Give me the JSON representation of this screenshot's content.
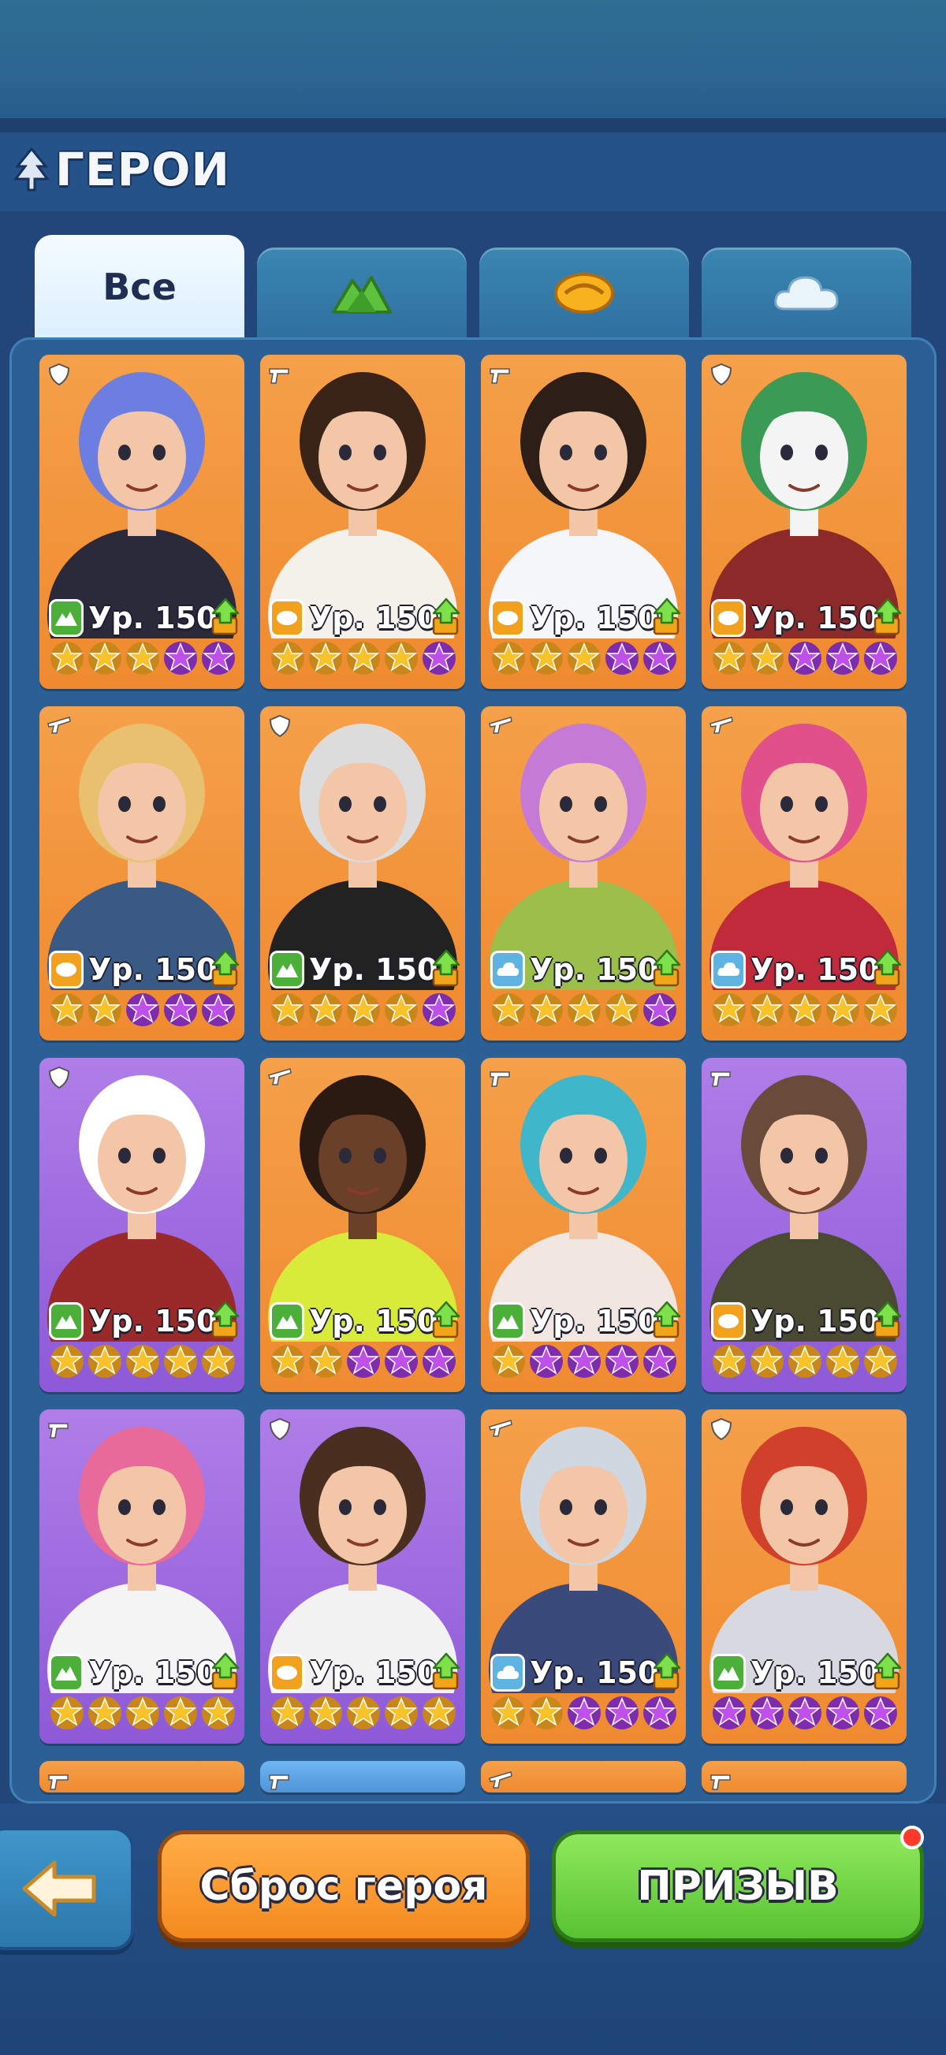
{
  "header": {
    "title": "ГЕРОИ",
    "title_icon": "tree-icon"
  },
  "tabs": [
    {
      "label": "Все",
      "icon": null,
      "active": true
    },
    {
      "label": "",
      "icon": "mountain-icon",
      "active": false
    },
    {
      "label": "",
      "icon": "sun-icon",
      "active": false
    },
    {
      "label": "",
      "icon": "cloud-icon",
      "active": false
    }
  ],
  "colors": {
    "orange_card": "#f29439",
    "purple_card": "#9d6ae0",
    "faction_mountain": "#4caf3a",
    "faction_sun": "#f2a11e",
    "faction_cloud": "#5fb3e0",
    "star_gold": "#f7c22a",
    "star_purple": "#c050ea"
  },
  "heroes": [
    {
      "rarity": "orange",
      "role": "shield-icon",
      "faction": "mountain",
      "level": "Ур. 150",
      "upgrade": "up-arrow-icon",
      "stars": [
        "gold",
        "gold",
        "gold",
        "purple",
        "purple"
      ],
      "character": "punk-guitarist"
    },
    {
      "rarity": "orange",
      "role": "gun-icon",
      "faction": "sun",
      "level": "Ур. 150",
      "upgrade": "up-arrow-icon",
      "stars": [
        "gold",
        "gold",
        "gold",
        "gold",
        "purple"
      ],
      "character": "curly-woman"
    },
    {
      "rarity": "orange",
      "role": "gun-icon",
      "faction": "sun",
      "level": "Ур. 150",
      "upgrade": "up-arrow-icon",
      "stars": [
        "gold",
        "gold",
        "gold",
        "purple",
        "purple"
      ],
      "character": "sailor-girl"
    },
    {
      "rarity": "orange",
      "role": "shield-icon",
      "faction": "sun",
      "level": "Ур. 150",
      "upgrade": "up-arrow-icon",
      "stars": [
        "gold",
        "gold",
        "purple",
        "purple",
        "purple"
      ],
      "character": "joker"
    },
    {
      "rarity": "orange",
      "role": "rifle-icon",
      "faction": "sun",
      "level": "Ур. 150",
      "upgrade": "up-arrow-icon",
      "stars": [
        "gold",
        "gold",
        "purple",
        "purple",
        "purple"
      ],
      "character": "blonde-gunner"
    },
    {
      "rarity": "orange",
      "role": "shield-icon",
      "faction": "mountain",
      "level": "Ур. 150",
      "upgrade": "up-arrow-icon",
      "stars": [
        "gold",
        "gold",
        "gold",
        "gold",
        "purple"
      ],
      "character": "cap-brawler"
    },
    {
      "rarity": "orange",
      "role": "rifle-icon",
      "faction": "cloud",
      "level": "Ур. 150",
      "upgrade": "up-arrow-icon",
      "stars": [
        "gold",
        "gold",
        "gold",
        "gold",
        "purple"
      ],
      "character": "beret-girl"
    },
    {
      "rarity": "orange",
      "role": "rifle-icon",
      "faction": "cloud",
      "level": "Ур. 150",
      "upgrade": "up-arrow-icon",
      "stars": [
        "gold",
        "gold",
        "gold",
        "gold",
        "gold"
      ],
      "character": "pink-twintails"
    },
    {
      "rarity": "purple",
      "role": "shield-icon",
      "faction": "mountain",
      "level": "Ур. 150",
      "upgrade": "up-arrow-icon",
      "stars": [
        "gold",
        "gold",
        "gold",
        "gold",
        "gold"
      ],
      "character": "chef"
    },
    {
      "rarity": "orange",
      "role": "rifle-icon",
      "faction": "mountain",
      "level": "Ур. 150",
      "upgrade": "up-arrow-icon",
      "stars": [
        "gold",
        "gold",
        "purple",
        "purple",
        "purple"
      ],
      "character": "gold-chain-man"
    },
    {
      "rarity": "orange",
      "role": "gun-icon",
      "faction": "mountain",
      "level": "Ур. 150",
      "upgrade": "up-arrow-icon",
      "stars": [
        "gold",
        "purple",
        "purple",
        "purple",
        "purple"
      ],
      "character": "monster-hat-girl"
    },
    {
      "rarity": "purple",
      "role": "gun-icon",
      "faction": "sun",
      "level": "Ур. 150",
      "upgrade": "up-arrow-icon",
      "stars": [
        "gold",
        "gold",
        "gold",
        "gold",
        "gold"
      ],
      "character": "bearded-hunter"
    },
    {
      "rarity": "purple",
      "role": "gun-icon",
      "faction": "mountain",
      "level": "Ур. 150",
      "upgrade": "up-arrow-icon",
      "stars": [
        "gold",
        "gold",
        "gold",
        "gold",
        "gold"
      ],
      "character": "pink-hair-girl"
    },
    {
      "rarity": "purple",
      "role": "shield-icon",
      "faction": "sun",
      "level": "Ур. 150",
      "upgrade": "up-arrow-icon",
      "stars": [
        "gold",
        "gold",
        "gold",
        "gold",
        "gold"
      ],
      "character": "tattoo-woman"
    },
    {
      "rarity": "orange",
      "role": "rifle-icon",
      "faction": "cloud",
      "level": "Ур. 150",
      "upgrade": "up-arrow-icon",
      "stars": [
        "gold",
        "gold",
        "purple",
        "purple",
        "purple"
      ],
      "character": "cap-mechanic"
    },
    {
      "rarity": "orange",
      "role": "shield-icon",
      "faction": "mountain",
      "level": "Ур. 150",
      "upgrade": "up-arrow-icon",
      "stars": [
        "purple",
        "purple",
        "purple",
        "purple",
        "purple"
      ],
      "character": "red-hair-brute"
    }
  ],
  "partial_row": [
    {
      "rarity": "orange",
      "role": "gun-icon"
    },
    {
      "rarity": "blue",
      "role": "gun-icon"
    },
    {
      "rarity": "orange",
      "role": "rifle-icon"
    },
    {
      "rarity": "orange",
      "role": "gun-icon"
    }
  ],
  "footer": {
    "back_icon": "arrow-left-icon",
    "reset_label": "Сброс героя",
    "summon_label": "ПРИЗЫВ",
    "summon_notification": true
  }
}
